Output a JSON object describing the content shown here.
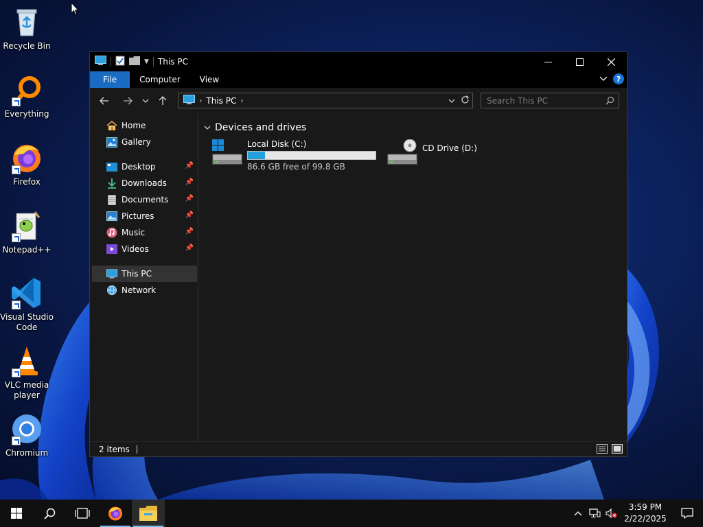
{
  "desktop": {
    "icons": [
      {
        "label": "Recycle Bin"
      },
      {
        "label": "Everything"
      },
      {
        "label": "Firefox"
      },
      {
        "label": "Notepad++"
      },
      {
        "label": "Visual Studio Code"
      },
      {
        "label": "VLC media player"
      },
      {
        "label": "Chromium"
      }
    ]
  },
  "window": {
    "title": "This PC",
    "ribbon_tabs": [
      "File",
      "Computer",
      "View"
    ],
    "address": {
      "crumb": "This PC"
    },
    "search_placeholder": "Search This PC",
    "nav": {
      "quick": [
        {
          "label": "Home"
        },
        {
          "label": "Gallery"
        }
      ],
      "pinned": [
        {
          "label": "Desktop"
        },
        {
          "label": "Downloads"
        },
        {
          "label": "Documents"
        },
        {
          "label": "Pictures"
        },
        {
          "label": "Music"
        },
        {
          "label": "Videos"
        }
      ],
      "system": [
        {
          "label": "This PC"
        },
        {
          "label": "Network"
        }
      ]
    },
    "group_header": "Devices and drives",
    "drives": [
      {
        "name": "Local Disk (C:)",
        "free_text": "86.6 GB free of 99.8 GB",
        "used_fraction": 0.132
      },
      {
        "name": "CD Drive (D:)"
      }
    ],
    "status": {
      "items": "2 items"
    }
  },
  "taskbar": {
    "clock_time": "3:59 PM",
    "clock_date": "2/22/2025"
  },
  "colors": {
    "accent": "#1a6bc2",
    "usage_fill": "#26a0da",
    "window_bg": "#191919"
  }
}
